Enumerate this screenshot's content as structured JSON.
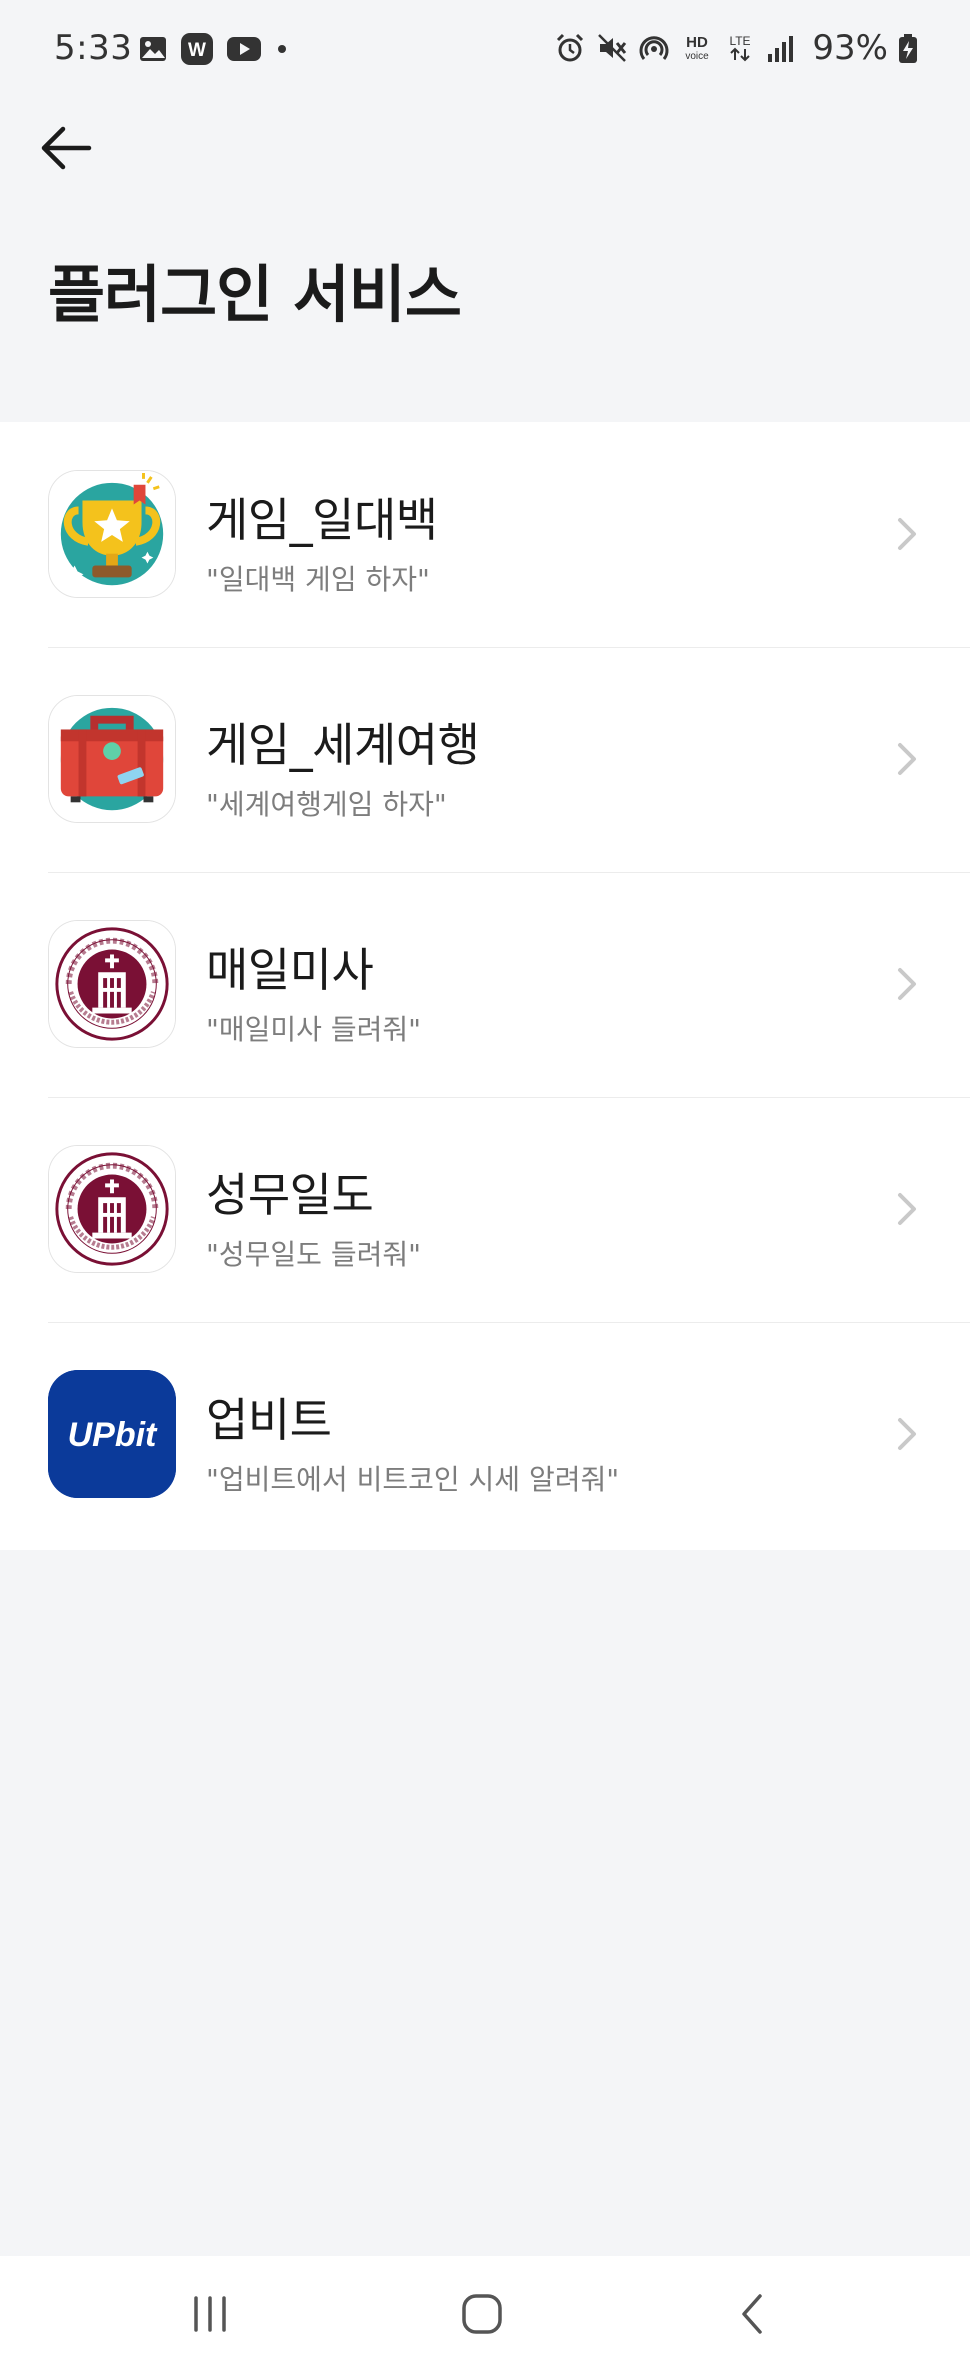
{
  "status_bar": {
    "time": "5:33",
    "left_icons": [
      "gallery-icon",
      "w-app-icon",
      "youtube-icon",
      "dot-icon"
    ],
    "right_icons": [
      "alarm-icon",
      "mute-icon",
      "hotspot-icon",
      "hd-voice-icon",
      "lte-icon",
      "signal-icon"
    ],
    "battery": "93%",
    "hd_label": "HD",
    "voice_label": "voice",
    "lte_label": "LTE",
    "w_label": "W"
  },
  "header": {
    "back_icon": "arrow-left-icon",
    "title": "플러그인 서비스"
  },
  "plugins": [
    {
      "title": "게임_일대백",
      "subtitle": "\"일대백 게임 하자\"",
      "icon": "trophy-icon"
    },
    {
      "title": "게임_세계여행",
      "subtitle": "\"세계여행게임 하자\"",
      "icon": "suitcase-icon"
    },
    {
      "title": "매일미사",
      "subtitle": "\"매일미사 들려줘\"",
      "icon": "archdiocese-seal-icon"
    },
    {
      "title": "성무일도",
      "subtitle": "\"성무일도 들려줘\"",
      "icon": "archdiocese-seal-icon"
    },
    {
      "title": "업비트",
      "subtitle": "\"업비트에서 비트코인 시세 알려줘\"",
      "icon": "upbit-logo-icon",
      "logo_text": "UPbit"
    }
  ],
  "seal": {
    "outer_text": "ARCHDIOCESE OF SEOUL",
    "korean_text": "천주교 서울대교구"
  },
  "nav_bar": {
    "buttons": [
      "recent-apps-icon",
      "home-icon",
      "back-nav-icon"
    ]
  },
  "colors": {
    "background": "#f4f5f7",
    "list_background": "#ffffff",
    "upbit_blue": "#0b3a9a",
    "seal_maroon": "#7a1035"
  }
}
